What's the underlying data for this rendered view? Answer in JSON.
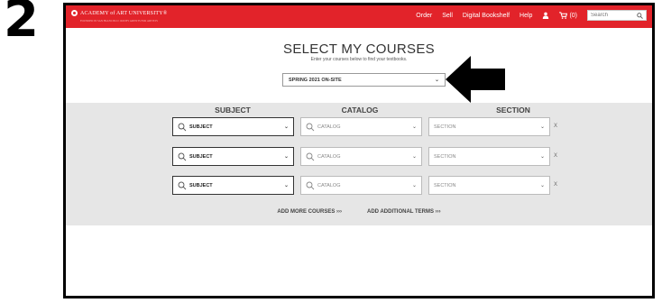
{
  "step_number": "2",
  "header": {
    "logo_text": "ACADEMY of ART UNIVERSITY®",
    "logo_subtext": "FOUNDED IN SAN FRANCISCO 1929 BY ARTISTS FOR ARTISTS",
    "nav": [
      "Order",
      "Sell",
      "Digital Bookshelf",
      "Help"
    ],
    "cart_label": "(0)",
    "search_placeholder": "Search"
  },
  "main": {
    "title": "SELECT MY COURSES",
    "subtitle": "Enter your courses below to find your textbooks.",
    "term_value": "SPRING 2021 ON-SITE"
  },
  "columns": {
    "subject": "SUBJECT",
    "catalog": "CATALOG",
    "section": "SECTION"
  },
  "rows": [
    {
      "subject": "SUBJECT",
      "catalog": "CATALOG",
      "section": "SECTION",
      "remove": "X"
    },
    {
      "subject": "SUBJECT",
      "catalog": "CATALOG",
      "section": "SECTION",
      "remove": "X"
    },
    {
      "subject": "SUBJECT",
      "catalog": "CATALOG",
      "section": "SECTION",
      "remove": "X"
    }
  ],
  "actions": {
    "add_courses": "ADD MORE COURSES ›››",
    "add_terms": "ADD ADDITIONAL TERMS ›››"
  },
  "colors": {
    "brand_red": "#e2232a",
    "panel_gray": "#e6e6e6"
  },
  "icons": [
    "logo-icon",
    "user-icon",
    "cart-icon",
    "search-icon",
    "magnifier-icon",
    "chevron-down-icon",
    "arrow-left-icon"
  ]
}
